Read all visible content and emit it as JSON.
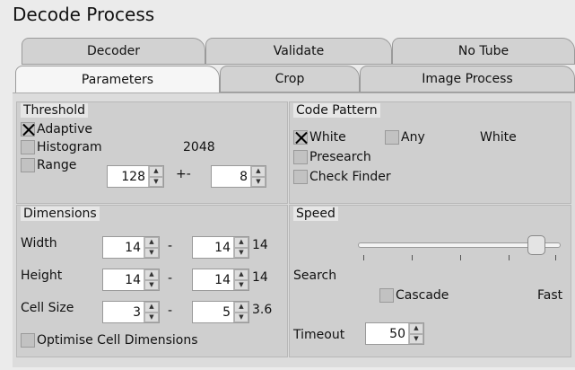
{
  "window": {
    "title": "Decode Process"
  },
  "tabs_row1": [
    {
      "label": "Decoder"
    },
    {
      "label": "Validate"
    },
    {
      "label": "No Tube"
    }
  ],
  "tabs_row2": [
    {
      "label": "Parameters",
      "active": true
    },
    {
      "label": "Crop"
    },
    {
      "label": "Image Process"
    }
  ],
  "threshold": {
    "title": "Threshold",
    "adaptive": {
      "label": "Adaptive",
      "checked": true
    },
    "histogram": {
      "label": "Histogram",
      "checked": false,
      "value": "2048"
    },
    "range": {
      "label": "Range",
      "checked": false,
      "value": "128",
      "plusminus_label": "+-",
      "tolerance": "8"
    }
  },
  "code_pattern": {
    "title": "Code Pattern",
    "white": {
      "label": "White",
      "checked": true
    },
    "any": {
      "label": "Any",
      "checked": false
    },
    "status": "White",
    "presearch": {
      "label": "Presearch",
      "checked": false
    },
    "check_finder": {
      "label": "Check Finder",
      "checked": false
    }
  },
  "dimensions": {
    "title": "Dimensions",
    "separator": "-",
    "width": {
      "label": "Width",
      "min": "14",
      "max": "14",
      "result": "14"
    },
    "height": {
      "label": "Height",
      "min": "14",
      "max": "14",
      "result": "14"
    },
    "cell_size": {
      "label": "Cell Size",
      "min": "3",
      "max": "5",
      "result": "3.6"
    },
    "optimise": {
      "label": "Optimise Cell Dimensions",
      "checked": false
    }
  },
  "speed": {
    "title": "Speed",
    "search_label": "Search",
    "cascade": {
      "label": "Cascade",
      "checked": false
    },
    "fast_label": "Fast",
    "slider_level": 0.88,
    "timeout": {
      "label": "Timeout",
      "value": "50"
    }
  },
  "icons": {
    "spin_up": "▲",
    "spin_down": "▼"
  },
  "colors": {
    "background": "#ebebeb",
    "tab_active": "#f6f6f6",
    "tab_inactive": "#d2d2d2",
    "group_bg": "#cfcfcf"
  }
}
